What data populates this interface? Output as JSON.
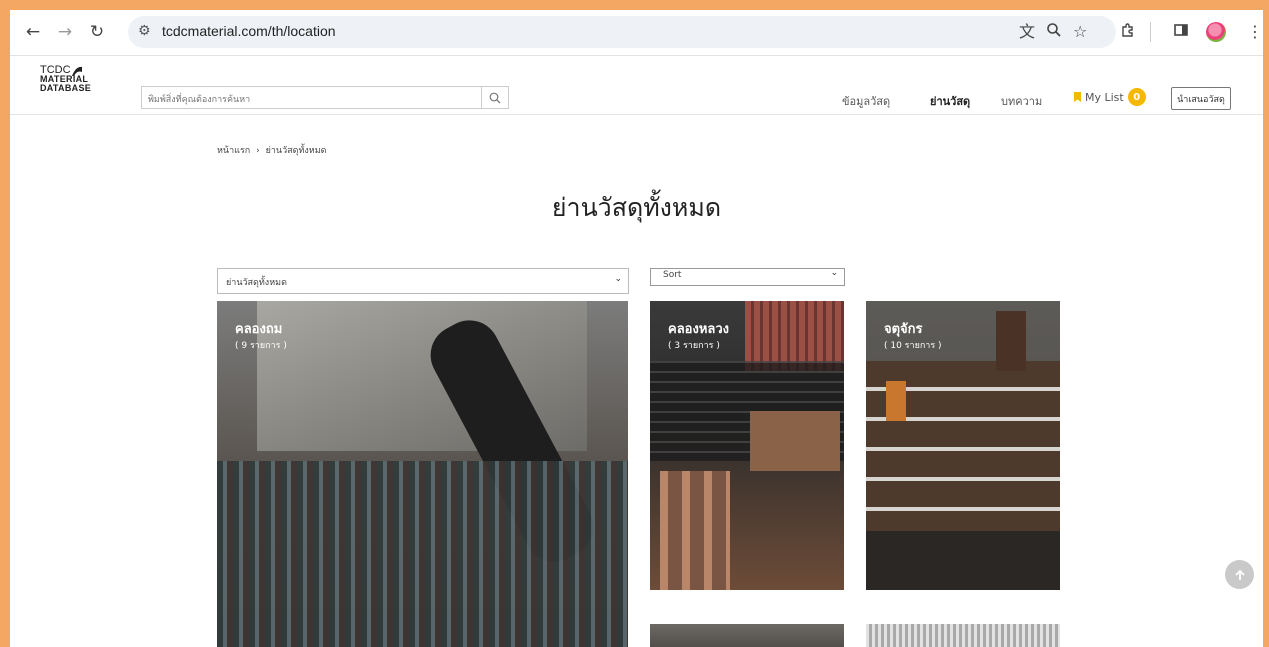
{
  "browser": {
    "url": "tcdcmaterial.com/th/location",
    "back_icon": "arrow-left-icon",
    "forward_icon": "arrow-right-icon",
    "reload_icon": "reload-icon"
  },
  "logo": {
    "line1": "TCDC",
    "line2": "MATERIAL",
    "line3": "DATABASE"
  },
  "search": {
    "placeholder": "พิมพ์สิ่งที่คุณต้องการค้นหา"
  },
  "nav": {
    "items": [
      {
        "label": "ข้อมูลวัสดุ",
        "active": false
      },
      {
        "label": "ย่านวัสดุ",
        "active": true
      },
      {
        "label": "บทความ",
        "active": false
      }
    ],
    "mylist_label": "My List",
    "mylist_count": "0",
    "submit_label": "นำเสนอวัสดุ"
  },
  "breadcrumb": {
    "home": "หน้าแรก",
    "separator": "›",
    "current": "ย่านวัสดุทั้งหมด"
  },
  "page_title": "ย่านวัสดุทั้งหมด",
  "filter": {
    "selected": "ย่านวัสดุทั้งหมด"
  },
  "sort": {
    "selected": "Sort"
  },
  "locations": [
    {
      "name": "คลองถม",
      "count": "( 9 รายการ )"
    },
    {
      "name": "คลองหลวง",
      "count": "( 3 รายการ )"
    },
    {
      "name": "จตุจักร",
      "count": "( 10 รายการ )"
    },
    {
      "name": "",
      "count": ""
    },
    {
      "name": "",
      "count": ""
    }
  ],
  "colors": {
    "accent": "#f5b800",
    "frame": "#f3a763"
  }
}
